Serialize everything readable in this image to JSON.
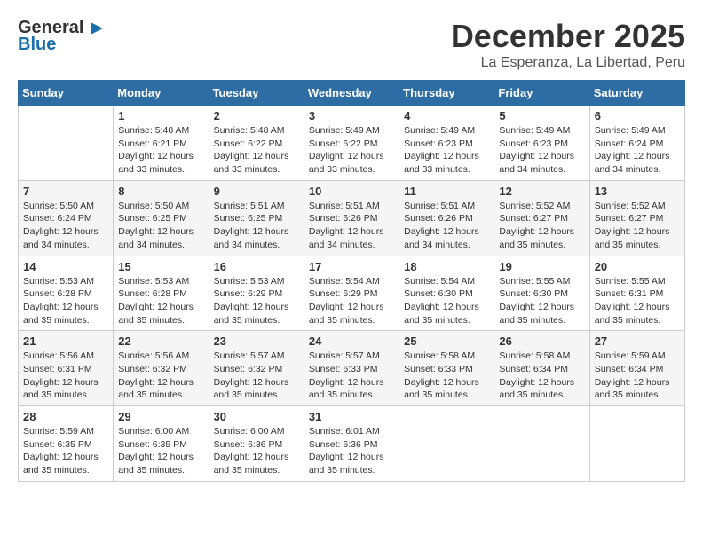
{
  "logo": {
    "general": "General",
    "blue": "Blue"
  },
  "header": {
    "month": "December 2025",
    "location": "La Esperanza, La Libertad, Peru"
  },
  "weekdays": [
    "Sunday",
    "Monday",
    "Tuesday",
    "Wednesday",
    "Thursday",
    "Friday",
    "Saturday"
  ],
  "weeks": [
    [
      {
        "day": "",
        "info": ""
      },
      {
        "day": "1",
        "info": "Sunrise: 5:48 AM\nSunset: 6:21 PM\nDaylight: 12 hours\nand 33 minutes."
      },
      {
        "day": "2",
        "info": "Sunrise: 5:48 AM\nSunset: 6:22 PM\nDaylight: 12 hours\nand 33 minutes."
      },
      {
        "day": "3",
        "info": "Sunrise: 5:49 AM\nSunset: 6:22 PM\nDaylight: 12 hours\nand 33 minutes."
      },
      {
        "day": "4",
        "info": "Sunrise: 5:49 AM\nSunset: 6:23 PM\nDaylight: 12 hours\nand 33 minutes."
      },
      {
        "day": "5",
        "info": "Sunrise: 5:49 AM\nSunset: 6:23 PM\nDaylight: 12 hours\nand 34 minutes."
      },
      {
        "day": "6",
        "info": "Sunrise: 5:49 AM\nSunset: 6:24 PM\nDaylight: 12 hours\nand 34 minutes."
      }
    ],
    [
      {
        "day": "7",
        "info": "Sunrise: 5:50 AM\nSunset: 6:24 PM\nDaylight: 12 hours\nand 34 minutes."
      },
      {
        "day": "8",
        "info": "Sunrise: 5:50 AM\nSunset: 6:25 PM\nDaylight: 12 hours\nand 34 minutes."
      },
      {
        "day": "9",
        "info": "Sunrise: 5:51 AM\nSunset: 6:25 PM\nDaylight: 12 hours\nand 34 minutes."
      },
      {
        "day": "10",
        "info": "Sunrise: 5:51 AM\nSunset: 6:26 PM\nDaylight: 12 hours\nand 34 minutes."
      },
      {
        "day": "11",
        "info": "Sunrise: 5:51 AM\nSunset: 6:26 PM\nDaylight: 12 hours\nand 34 minutes."
      },
      {
        "day": "12",
        "info": "Sunrise: 5:52 AM\nSunset: 6:27 PM\nDaylight: 12 hours\nand 35 minutes."
      },
      {
        "day": "13",
        "info": "Sunrise: 5:52 AM\nSunset: 6:27 PM\nDaylight: 12 hours\nand 35 minutes."
      }
    ],
    [
      {
        "day": "14",
        "info": "Sunrise: 5:53 AM\nSunset: 6:28 PM\nDaylight: 12 hours\nand 35 minutes."
      },
      {
        "day": "15",
        "info": "Sunrise: 5:53 AM\nSunset: 6:28 PM\nDaylight: 12 hours\nand 35 minutes."
      },
      {
        "day": "16",
        "info": "Sunrise: 5:53 AM\nSunset: 6:29 PM\nDaylight: 12 hours\nand 35 minutes."
      },
      {
        "day": "17",
        "info": "Sunrise: 5:54 AM\nSunset: 6:29 PM\nDaylight: 12 hours\nand 35 minutes."
      },
      {
        "day": "18",
        "info": "Sunrise: 5:54 AM\nSunset: 6:30 PM\nDaylight: 12 hours\nand 35 minutes."
      },
      {
        "day": "19",
        "info": "Sunrise: 5:55 AM\nSunset: 6:30 PM\nDaylight: 12 hours\nand 35 minutes."
      },
      {
        "day": "20",
        "info": "Sunrise: 5:55 AM\nSunset: 6:31 PM\nDaylight: 12 hours\nand 35 minutes."
      }
    ],
    [
      {
        "day": "21",
        "info": "Sunrise: 5:56 AM\nSunset: 6:31 PM\nDaylight: 12 hours\nand 35 minutes."
      },
      {
        "day": "22",
        "info": "Sunrise: 5:56 AM\nSunset: 6:32 PM\nDaylight: 12 hours\nand 35 minutes."
      },
      {
        "day": "23",
        "info": "Sunrise: 5:57 AM\nSunset: 6:32 PM\nDaylight: 12 hours\nand 35 minutes."
      },
      {
        "day": "24",
        "info": "Sunrise: 5:57 AM\nSunset: 6:33 PM\nDaylight: 12 hours\nand 35 minutes."
      },
      {
        "day": "25",
        "info": "Sunrise: 5:58 AM\nSunset: 6:33 PM\nDaylight: 12 hours\nand 35 minutes."
      },
      {
        "day": "26",
        "info": "Sunrise: 5:58 AM\nSunset: 6:34 PM\nDaylight: 12 hours\nand 35 minutes."
      },
      {
        "day": "27",
        "info": "Sunrise: 5:59 AM\nSunset: 6:34 PM\nDaylight: 12 hours\nand 35 minutes."
      }
    ],
    [
      {
        "day": "28",
        "info": "Sunrise: 5:59 AM\nSunset: 6:35 PM\nDaylight: 12 hours\nand 35 minutes."
      },
      {
        "day": "29",
        "info": "Sunrise: 6:00 AM\nSunset: 6:35 PM\nDaylight: 12 hours\nand 35 minutes."
      },
      {
        "day": "30",
        "info": "Sunrise: 6:00 AM\nSunset: 6:36 PM\nDaylight: 12 hours\nand 35 minutes."
      },
      {
        "day": "31",
        "info": "Sunrise: 6:01 AM\nSunset: 6:36 PM\nDaylight: 12 hours\nand 35 minutes."
      },
      {
        "day": "",
        "info": ""
      },
      {
        "day": "",
        "info": ""
      },
      {
        "day": "",
        "info": ""
      }
    ]
  ]
}
